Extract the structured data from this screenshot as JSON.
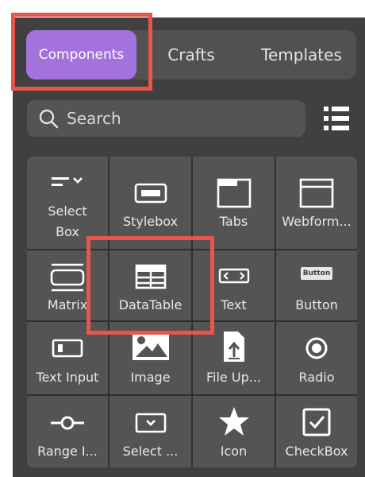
{
  "tabs": {
    "components": "Components",
    "crafts": "Crafts",
    "templates": "Templates"
  },
  "search": {
    "placeholder": "Search"
  },
  "components": {
    "select_box": "Select\nBox",
    "stylebox": "Stylebox",
    "tabs": "Tabs",
    "webform": "Webform...",
    "matrix": "Matrix",
    "datatable": "DataTable",
    "text": "Text",
    "button": "Button",
    "button_icon_text": "Button",
    "text_input": "Text Input",
    "image": "Image",
    "file_upload": "File Up...",
    "radio": "Radio",
    "range_input": "Range I...",
    "select": "Select ...",
    "icon": "Icon",
    "checkbox": "CheckBox"
  },
  "colors": {
    "accent": "#a373dd",
    "highlight": "#e8554d"
  }
}
